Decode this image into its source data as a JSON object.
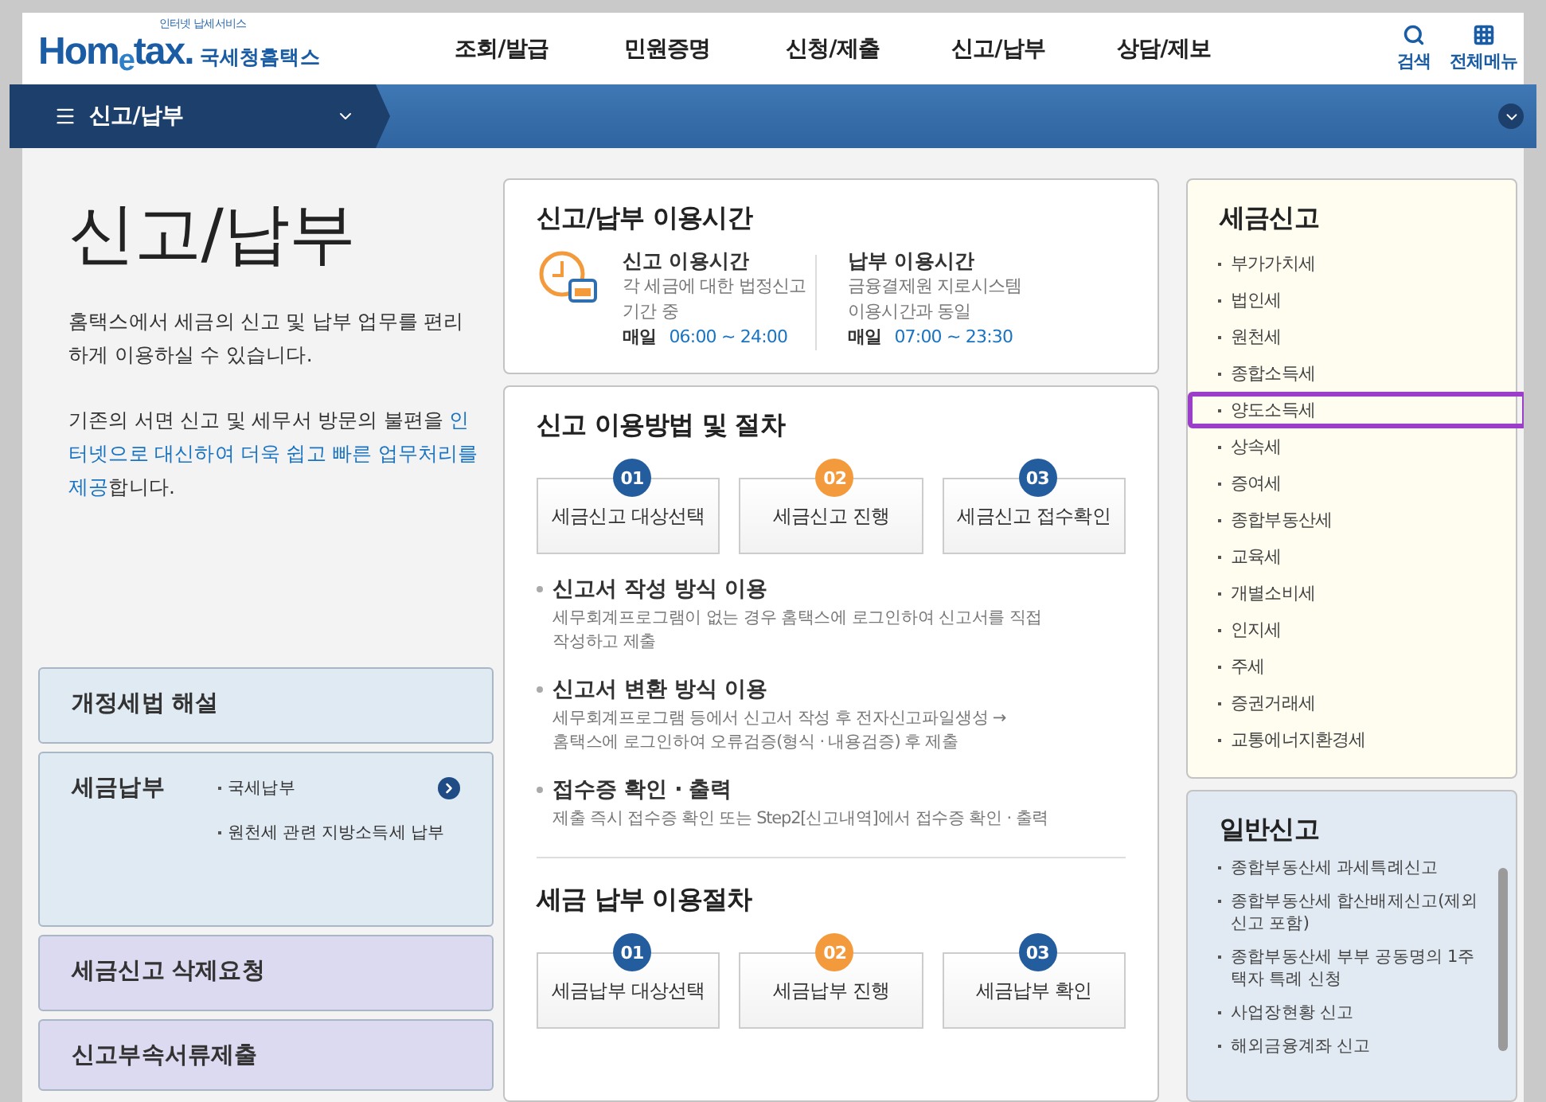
{
  "header": {
    "logo": {
      "tagline": "인터넷 납세서비스",
      "wordmark": "Hom$_{e}$tax.",
      "name": "국세청홈택스"
    },
    "menu": [
      "조회/발급",
      "민원증명",
      "신청/제출",
      "신고/납부",
      "상담/제보"
    ],
    "tools": [
      {
        "kind": "search",
        "label": "검색"
      },
      {
        "kind": "grid",
        "label": "전체메뉴"
      }
    ]
  },
  "nav": {
    "current": "신고/납부"
  },
  "intro": {
    "title": "신고/납부",
    "paragraphs": [
      [
        {
          "text": "홈택스에서 세금의 신고 및 납부 업무를 편리하게 이용하실 수 있습니다.",
          "highlight": false
        }
      ],
      [
        {
          "text": "기존의 서면 신고 및 세무서 방문의 불편을 ",
          "highlight": false
        },
        {
          "text": "인터넷으로 대신하여 더욱 쉽고 빠른 업무처리를 제공",
          "highlight": true
        },
        {
          "text": "합니다.",
          "highlight": false
        }
      ]
    ]
  },
  "left_cards": [
    {
      "title": "개정세법 해설",
      "color": "#e0eaf3"
    },
    {
      "title": "세금납부",
      "color": "#e0eaf3",
      "links": [
        "국세납부",
        "원천세 관련 지방소득세 납부"
      ]
    },
    {
      "title": "세금신고 삭제요청",
      "color": "#dcdaf0"
    },
    {
      "title": "신고부속서류제출",
      "color": "#dcdaf0"
    }
  ],
  "hours": {
    "title": "신고/납부 이용시간",
    "columns": [
      {
        "title": "신고 이용시간",
        "lines": [
          "각 세금에 대한 법정신고",
          "기간 중"
        ],
        "daily": "매일",
        "time": "06:00 ~ 24:00"
      },
      {
        "title": "납부 이용시간",
        "lines": [
          "금융결제원 지로시스템",
          "이용시간과 동일"
        ],
        "daily": "매일",
        "time": "07:00 ~ 23:30"
      }
    ]
  },
  "procedure": {
    "title": "신고 이용방법 및 절차",
    "steps": [
      {
        "number": "01",
        "label": "세금신고 대상선택",
        "active": false
      },
      {
        "number": "02",
        "label": "세금신고 진행",
        "active": true
      },
      {
        "number": "03",
        "label": "세금신고 접수확인",
        "active": false
      }
    ],
    "methods": [
      {
        "title": "신고서 작성 방식 이용",
        "lines": [
          "세무회계프로그램이 없는 경우 홈택스에 로그인하여 신고서를 직접",
          "작성하고 제출"
        ]
      },
      {
        "title": "신고서 변환 방식 이용",
        "lines": [
          "세무회계프로그램 등에서 신고서 작성 후 전자신고파일생성 →",
          "홈택스에 로그인하여 오류검증(형식 · 내용검증) 후 제출"
        ]
      },
      {
        "title": "접수증 확인 · 출력",
        "lines": [
          "제출 즉시 접수증 확인 또는 Step2[신고내역]에서 접수증 확인 · 출력"
        ]
      }
    ],
    "payment_title": "세금 납부 이용절차",
    "payment_steps": [
      {
        "number": "01",
        "label": "세금납부 대상선택",
        "active": false
      },
      {
        "number": "02",
        "label": "세금납부 진행",
        "active": true
      },
      {
        "number": "03",
        "label": "세금납부 확인",
        "active": false
      }
    ]
  },
  "tax_filing": {
    "title": "세금신고",
    "items": [
      {
        "label": "부가가치세",
        "highlighted": false
      },
      {
        "label": "법인세",
        "highlighted": false
      },
      {
        "label": "원천세",
        "highlighted": false
      },
      {
        "label": "종합소득세",
        "highlighted": false
      },
      {
        "label": "양도소득세",
        "highlighted": true
      },
      {
        "label": "상속세",
        "highlighted": false
      },
      {
        "label": "증여세",
        "highlighted": false
      },
      {
        "label": "종합부동산세",
        "highlighted": false
      },
      {
        "label": "교육세",
        "highlighted": false
      },
      {
        "label": "개별소비세",
        "highlighted": false
      },
      {
        "label": "인지세",
        "highlighted": false
      },
      {
        "label": "주세",
        "highlighted": false
      },
      {
        "label": "증권거래세",
        "highlighted": false
      },
      {
        "label": "교통에너지환경세",
        "highlighted": false
      }
    ]
  },
  "general_filing": {
    "title": "일반신고",
    "items": [
      "종합부동산세 과세특례신고",
      "종합부동산세 합산배제신고(제외신고 포함)",
      "종합부동산세 부부 공동명의 1주택자 특례 신청",
      "사업장현황 신고",
      "해외금융계좌 신고"
    ]
  }
}
